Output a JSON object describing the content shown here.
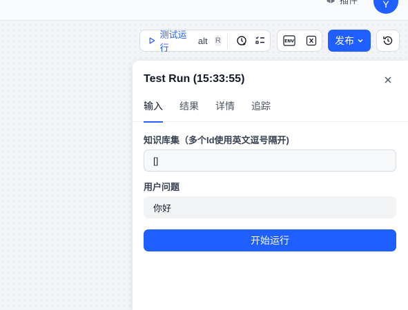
{
  "topbar": {
    "plugin_label": "插件",
    "avatar_initial": "Y"
  },
  "toolbar": {
    "test_run_label": "测试运行",
    "shortcut_modifier": "alt",
    "shortcut_key": "R",
    "publish_label": "发布",
    "env_icon": "env-icon",
    "variable_icon": "variable-icon",
    "history_icon": "history-icon",
    "accent_color": "#1f5eff"
  },
  "panel": {
    "title": "Test Run (15:33:55)",
    "tabs": [
      {
        "label": "输入",
        "active": true
      },
      {
        "label": "结果",
        "active": false
      },
      {
        "label": "详情",
        "active": false
      },
      {
        "label": "追踪",
        "active": false
      }
    ],
    "fields": [
      {
        "label": "知识库集（多个Id使用英文逗号隔开)",
        "value": "[]"
      },
      {
        "label": "用户问题",
        "value": "你好"
      }
    ],
    "start_button_label": "开始运行"
  }
}
